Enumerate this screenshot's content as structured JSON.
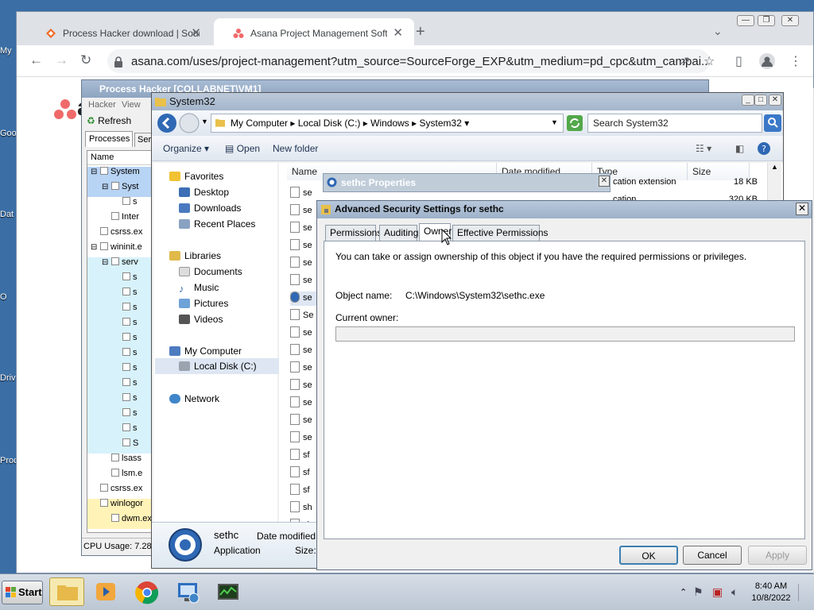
{
  "desktop": {
    "icons": [
      "My",
      "Goo",
      "Dat",
      "O",
      "Driv",
      "Proc"
    ]
  },
  "chrome": {
    "tabs": [
      {
        "label": "Process Hacker download | SourceF",
        "active": false
      },
      {
        "label": "Asana Project Management Softwar",
        "active": true
      }
    ],
    "new_tab": "+",
    "url": "asana.com/uses/project-management?utm_source=SourceForge_EXP&utm_medium=pd_cpc&utm_campai...",
    "page_logo_text": "as"
  },
  "process_hacker": {
    "title": "Process Hacker [COLLABNET\\VM1]",
    "menu": [
      "Hacker",
      "View"
    ],
    "refresh_label": "Refresh",
    "tabs": [
      "Processes",
      "Ser"
    ],
    "column": "Name",
    "rows": [
      {
        "label": "System",
        "indent": 0,
        "expander": "⊟",
        "selected": true
      },
      {
        "label": "Syst",
        "indent": 1,
        "expander": "⊟",
        "selected": true
      },
      {
        "label": "s",
        "indent": 2,
        "expander": "",
        "selected": false
      },
      {
        "label": "Inter",
        "indent": 1,
        "expander": "",
        "selected": false
      },
      {
        "label": "csrss.ex",
        "indent": 0,
        "expander": "",
        "selected": false
      },
      {
        "label": "wininit.e",
        "indent": 0,
        "expander": "⊟",
        "selected": false
      },
      {
        "label": "serv",
        "indent": 1,
        "expander": "⊟",
        "selected": false
      },
      {
        "label": "s",
        "indent": 2,
        "expander": "",
        "selected": false
      },
      {
        "label": "s",
        "indent": 2,
        "expander": "",
        "selected": false
      },
      {
        "label": "s",
        "indent": 2,
        "expander": "",
        "selected": false
      },
      {
        "label": "s",
        "indent": 2,
        "expander": "",
        "selected": false
      },
      {
        "label": "s",
        "indent": 2,
        "expander": "",
        "selected": false
      },
      {
        "label": "s",
        "indent": 2,
        "expander": "",
        "selected": false
      },
      {
        "label": "s",
        "indent": 2,
        "expander": "",
        "selected": false
      },
      {
        "label": "s",
        "indent": 2,
        "expander": "",
        "selected": false
      },
      {
        "label": "s",
        "indent": 2,
        "expander": "",
        "selected": false
      },
      {
        "label": "s",
        "indent": 2,
        "expander": "",
        "selected": false
      },
      {
        "label": "s",
        "indent": 2,
        "expander": "",
        "selected": false
      },
      {
        "label": "S",
        "indent": 2,
        "expander": "",
        "selected": false
      },
      {
        "label": "lsass",
        "indent": 1,
        "expander": "",
        "selected": false
      },
      {
        "label": "lsm.e",
        "indent": 1,
        "expander": "",
        "selected": false
      },
      {
        "label": "csrss.ex",
        "indent": 0,
        "expander": "",
        "selected": false
      },
      {
        "label": "winlogor",
        "indent": 0,
        "expander": "",
        "selected": false
      },
      {
        "label": "dwm.ex",
        "indent": 1,
        "expander": "",
        "selected": false
      }
    ],
    "status": "CPU Usage: 7.28"
  },
  "explorer": {
    "title": "System32",
    "breadcrumb": [
      "My Computer",
      "Local Disk (C:)",
      "Windows",
      "System32"
    ],
    "search_placeholder": "Search System32",
    "commands": {
      "organize": "Organize",
      "open": "Open",
      "new_folder": "New folder"
    },
    "nav": {
      "favorites": "Favorites",
      "desktop": "Desktop",
      "downloads": "Downloads",
      "recent": "Recent Places",
      "libraries": "Libraries",
      "documents": "Documents",
      "music": "Music",
      "pictures": "Pictures",
      "videos": "Videos",
      "my_computer": "My Computer",
      "local_disk": "Local Disk (C:)",
      "network": "Network"
    },
    "columns": [
      "Name",
      "Date modified",
      "Type",
      "Size"
    ],
    "partial_rows": [
      {
        "type": "cation extension",
        "size": "18 KB"
      },
      {
        "type": "cation",
        "size": "320 KB"
      }
    ],
    "files": [
      "se",
      "se",
      "se",
      "se",
      "se",
      "se",
      "se",
      "Se",
      "se",
      "se",
      "se",
      "se",
      "se",
      "se",
      "se",
      "sf",
      "sf",
      "sf",
      "sh",
      "sh"
    ],
    "details": {
      "name": "sethc",
      "kind": "Application",
      "date_label": "Date modified:",
      "size_label": "Size:"
    }
  },
  "sethc_properties": {
    "title": "sethc Properties"
  },
  "advanced_security": {
    "title": "Advanced Security Settings for sethc",
    "tabs": [
      "Permissions",
      "Auditing",
      "Owner",
      "Effective Permissions"
    ],
    "selected_tab": "Owner",
    "info": "You can take or assign ownership of this object if you have the required permissions or privileges.",
    "object_name_label": "Object name:",
    "object_name_value": "C:\\Windows\\System32\\sethc.exe",
    "current_owner_label": "Current owner:",
    "current_owner_value": "",
    "buttons": {
      "ok": "OK",
      "cancel": "Cancel",
      "apply": "Apply"
    }
  },
  "taskbar": {
    "start": "Start",
    "time": "8:40 AM",
    "date": "10/8/2022"
  }
}
